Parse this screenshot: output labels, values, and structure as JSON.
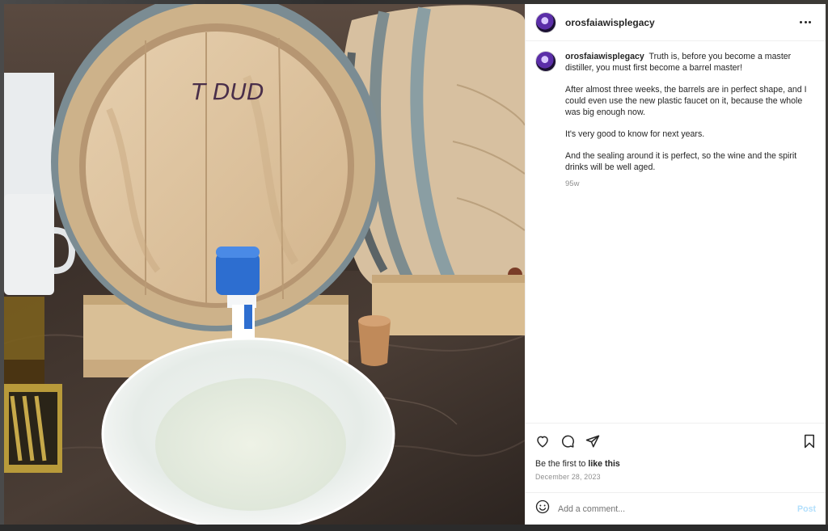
{
  "post": {
    "username": "orosfaiawisplegacy",
    "caption": {
      "username": "orosfaiawisplegacy",
      "lead": "Truth is, before you become a master distiller, you must first become a barrel master!",
      "paragraphs": [
        "After almost three weeks, the barrels are in perfect shape, and I could even use the new plastic faucet on it, because the whole was big enough now.",
        "It's very good to know for next years.",
        "And the sealing around it is perfect, so the wine and the spirit drinks will be well aged."
      ]
    },
    "time_ago": "95w",
    "likes_prefix": "Be the first to",
    "likes_link": "like this",
    "date": "December 28, 2023"
  },
  "comment_box": {
    "placeholder": "Add a comment...",
    "post_label": "Post"
  },
  "photo": {
    "barrel_marking": "T DUD"
  },
  "icons": {
    "more": "more-options-icon",
    "like": "heart-icon",
    "comment": "comment-icon",
    "share": "share-icon",
    "save": "bookmark-icon",
    "emoji": "emoji-icon"
  },
  "colors": {
    "accent_disabled": "#b2dffc",
    "text": "#262626",
    "muted": "#8e8e8e"
  }
}
